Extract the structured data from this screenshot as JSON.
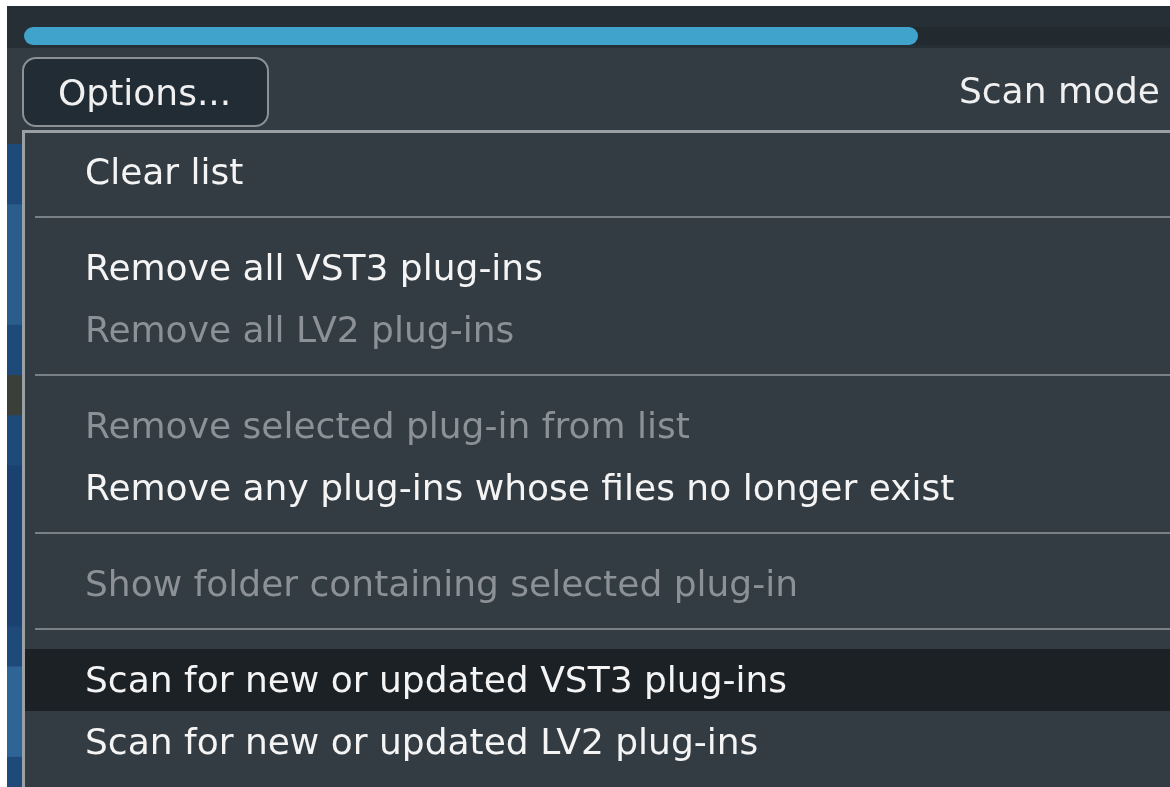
{
  "progress": {
    "level": 0.78
  },
  "options_button": {
    "label": "Options..."
  },
  "scan_mode": {
    "label": "Scan mode"
  },
  "menu": [
    {
      "kind": "item",
      "label": "Clear list",
      "disabled": false,
      "selected": false
    },
    {
      "kind": "separator"
    },
    {
      "kind": "item",
      "label": "Remove all VST3 plug-ins",
      "disabled": false,
      "selected": false
    },
    {
      "kind": "item",
      "label": "Remove all LV2 plug-ins",
      "disabled": true,
      "selected": false
    },
    {
      "kind": "separator"
    },
    {
      "kind": "item",
      "label": "Remove selected plug-in from list",
      "disabled": true,
      "selected": false
    },
    {
      "kind": "item",
      "label": "Remove any plug-ins whose files no longer exist",
      "disabled": false,
      "selected": false
    },
    {
      "kind": "separator"
    },
    {
      "kind": "item",
      "label": "Show folder containing selected plug-in",
      "disabled": true,
      "selected": false
    },
    {
      "kind": "separator"
    },
    {
      "kind": "item",
      "label": "Scan for new or updated VST3 plug-ins",
      "disabled": false,
      "selected": true
    },
    {
      "kind": "item",
      "label": "Scan for new or updated LV2 plug-ins",
      "disabled": false,
      "selected": false
    }
  ]
}
